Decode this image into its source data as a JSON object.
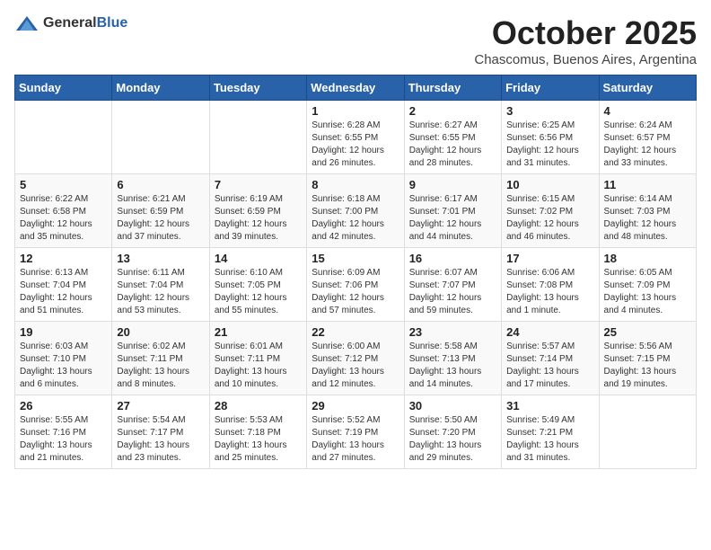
{
  "logo": {
    "general": "General",
    "blue": "Blue"
  },
  "header": {
    "month": "October 2025",
    "location": "Chascomus, Buenos Aires, Argentina"
  },
  "weekdays": [
    "Sunday",
    "Monday",
    "Tuesday",
    "Wednesday",
    "Thursday",
    "Friday",
    "Saturday"
  ],
  "weeks": [
    [
      {
        "day": "",
        "info": ""
      },
      {
        "day": "",
        "info": ""
      },
      {
        "day": "",
        "info": ""
      },
      {
        "day": "1",
        "info": "Sunrise: 6:28 AM\nSunset: 6:55 PM\nDaylight: 12 hours\nand 26 minutes."
      },
      {
        "day": "2",
        "info": "Sunrise: 6:27 AM\nSunset: 6:55 PM\nDaylight: 12 hours\nand 28 minutes."
      },
      {
        "day": "3",
        "info": "Sunrise: 6:25 AM\nSunset: 6:56 PM\nDaylight: 12 hours\nand 31 minutes."
      },
      {
        "day": "4",
        "info": "Sunrise: 6:24 AM\nSunset: 6:57 PM\nDaylight: 12 hours\nand 33 minutes."
      }
    ],
    [
      {
        "day": "5",
        "info": "Sunrise: 6:22 AM\nSunset: 6:58 PM\nDaylight: 12 hours\nand 35 minutes."
      },
      {
        "day": "6",
        "info": "Sunrise: 6:21 AM\nSunset: 6:59 PM\nDaylight: 12 hours\nand 37 minutes."
      },
      {
        "day": "7",
        "info": "Sunrise: 6:19 AM\nSunset: 6:59 PM\nDaylight: 12 hours\nand 39 minutes."
      },
      {
        "day": "8",
        "info": "Sunrise: 6:18 AM\nSunset: 7:00 PM\nDaylight: 12 hours\nand 42 minutes."
      },
      {
        "day": "9",
        "info": "Sunrise: 6:17 AM\nSunset: 7:01 PM\nDaylight: 12 hours\nand 44 minutes."
      },
      {
        "day": "10",
        "info": "Sunrise: 6:15 AM\nSunset: 7:02 PM\nDaylight: 12 hours\nand 46 minutes."
      },
      {
        "day": "11",
        "info": "Sunrise: 6:14 AM\nSunset: 7:03 PM\nDaylight: 12 hours\nand 48 minutes."
      }
    ],
    [
      {
        "day": "12",
        "info": "Sunrise: 6:13 AM\nSunset: 7:04 PM\nDaylight: 12 hours\nand 51 minutes."
      },
      {
        "day": "13",
        "info": "Sunrise: 6:11 AM\nSunset: 7:04 PM\nDaylight: 12 hours\nand 53 minutes."
      },
      {
        "day": "14",
        "info": "Sunrise: 6:10 AM\nSunset: 7:05 PM\nDaylight: 12 hours\nand 55 minutes."
      },
      {
        "day": "15",
        "info": "Sunrise: 6:09 AM\nSunset: 7:06 PM\nDaylight: 12 hours\nand 57 minutes."
      },
      {
        "day": "16",
        "info": "Sunrise: 6:07 AM\nSunset: 7:07 PM\nDaylight: 12 hours\nand 59 minutes."
      },
      {
        "day": "17",
        "info": "Sunrise: 6:06 AM\nSunset: 7:08 PM\nDaylight: 13 hours\nand 1 minute."
      },
      {
        "day": "18",
        "info": "Sunrise: 6:05 AM\nSunset: 7:09 PM\nDaylight: 13 hours\nand 4 minutes."
      }
    ],
    [
      {
        "day": "19",
        "info": "Sunrise: 6:03 AM\nSunset: 7:10 PM\nDaylight: 13 hours\nand 6 minutes."
      },
      {
        "day": "20",
        "info": "Sunrise: 6:02 AM\nSunset: 7:11 PM\nDaylight: 13 hours\nand 8 minutes."
      },
      {
        "day": "21",
        "info": "Sunrise: 6:01 AM\nSunset: 7:11 PM\nDaylight: 13 hours\nand 10 minutes."
      },
      {
        "day": "22",
        "info": "Sunrise: 6:00 AM\nSunset: 7:12 PM\nDaylight: 13 hours\nand 12 minutes."
      },
      {
        "day": "23",
        "info": "Sunrise: 5:58 AM\nSunset: 7:13 PM\nDaylight: 13 hours\nand 14 minutes."
      },
      {
        "day": "24",
        "info": "Sunrise: 5:57 AM\nSunset: 7:14 PM\nDaylight: 13 hours\nand 17 minutes."
      },
      {
        "day": "25",
        "info": "Sunrise: 5:56 AM\nSunset: 7:15 PM\nDaylight: 13 hours\nand 19 minutes."
      }
    ],
    [
      {
        "day": "26",
        "info": "Sunrise: 5:55 AM\nSunset: 7:16 PM\nDaylight: 13 hours\nand 21 minutes."
      },
      {
        "day": "27",
        "info": "Sunrise: 5:54 AM\nSunset: 7:17 PM\nDaylight: 13 hours\nand 23 minutes."
      },
      {
        "day": "28",
        "info": "Sunrise: 5:53 AM\nSunset: 7:18 PM\nDaylight: 13 hours\nand 25 minutes."
      },
      {
        "day": "29",
        "info": "Sunrise: 5:52 AM\nSunset: 7:19 PM\nDaylight: 13 hours\nand 27 minutes."
      },
      {
        "day": "30",
        "info": "Sunrise: 5:50 AM\nSunset: 7:20 PM\nDaylight: 13 hours\nand 29 minutes."
      },
      {
        "day": "31",
        "info": "Sunrise: 5:49 AM\nSunset: 7:21 PM\nDaylight: 13 hours\nand 31 minutes."
      },
      {
        "day": "",
        "info": ""
      }
    ]
  ]
}
